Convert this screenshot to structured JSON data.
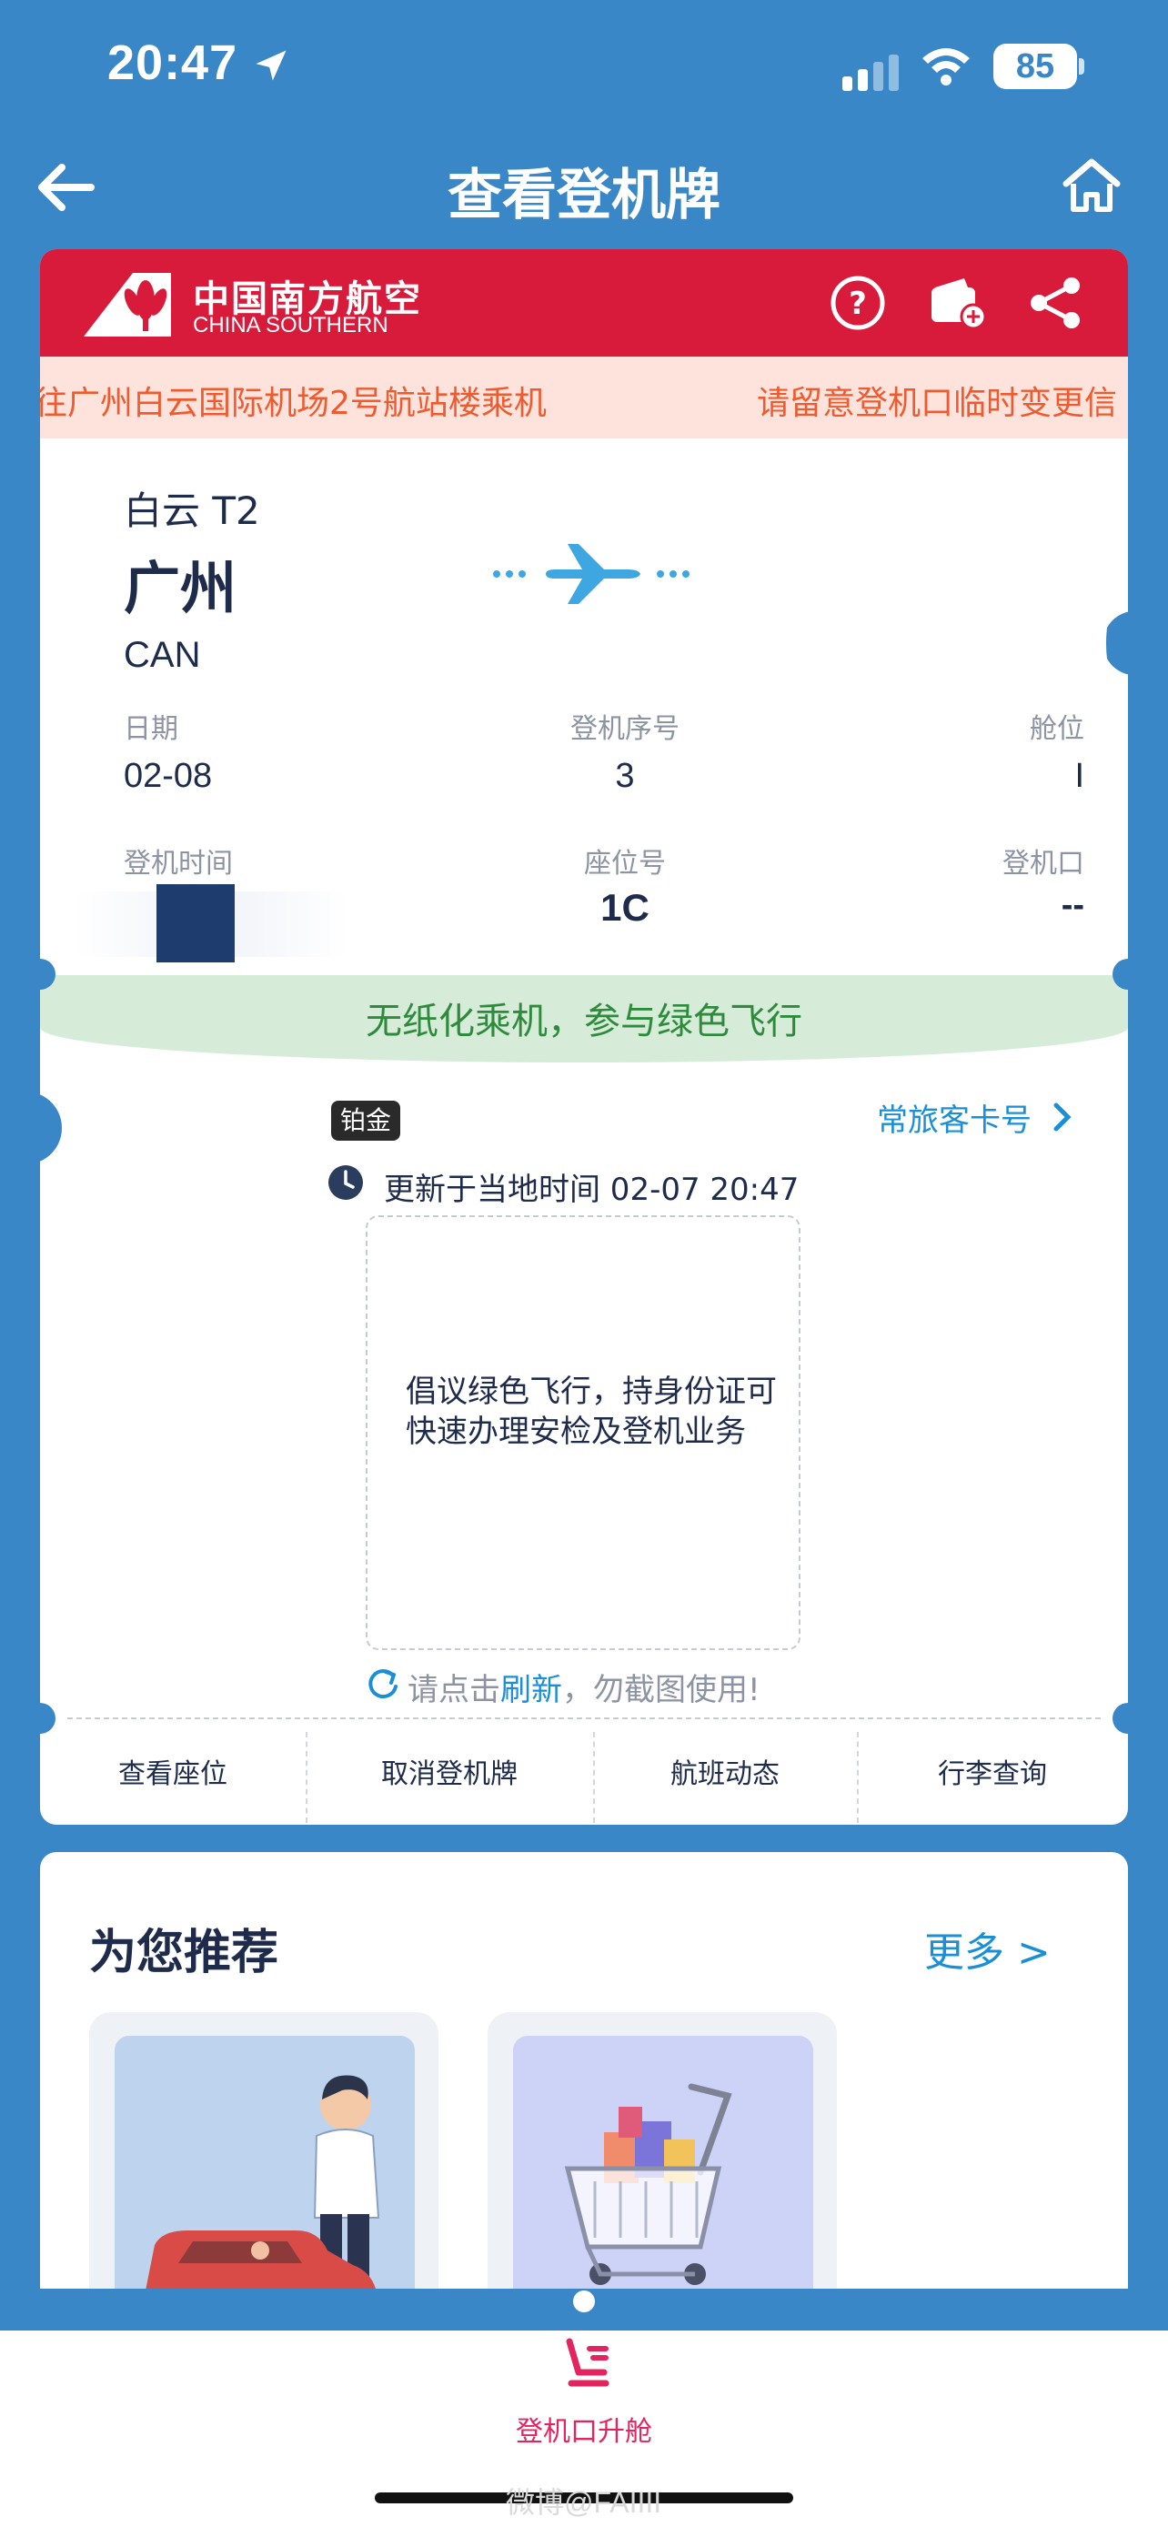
{
  "status_bar": {
    "time": "20:47",
    "battery": "85"
  },
  "nav": {
    "title": "查看登机牌"
  },
  "header": {
    "logo_cn": "中国南方航空",
    "logo_en": "CHINA SOUTHERN"
  },
  "marquee": {
    "text1": "往广州白云国际机场2号航站楼乘机",
    "text2": "请留意登机口临时变更信"
  },
  "origin": {
    "terminal": "白云 T2",
    "city": "广州",
    "code": "CAN"
  },
  "fields": {
    "date_label": "日期",
    "date": "02-08",
    "seq_label": "登机序号",
    "seq": "3",
    "cabin_label": "舱位",
    "cabin": "I",
    "btime_label": "登机时间",
    "seat_label": "座位号",
    "seat": "1C",
    "gate_label": "登机口",
    "gate": "--"
  },
  "green_banner": "无纸化乘机，参与绿色飞行",
  "member": {
    "tier": "铂金",
    "ff_link": "常旅客卡号"
  },
  "updated": "更新于当地时间 02-07 20:47",
  "qr_message": "倡议绿色飞行，持身份证可快速办理安检及登机业务",
  "refresh": {
    "prefix": "请点击",
    "link": "刷新",
    "suffix": "，勿截图使用!"
  },
  "actions": [
    "查看座位",
    "取消登机牌",
    "航班动态",
    "行李查询"
  ],
  "recommend": {
    "title": "为您推荐",
    "more": "更多 >"
  },
  "bottom": {
    "upgrade_label": "登机口升舱"
  },
  "watermark": "微博@FAIIII",
  "colors": {
    "brand_red": "#d81a3b",
    "page_blue": "#3a87c7",
    "link_blue": "#1b8fd6",
    "green_text": "#2f8b3c",
    "marquee_orange": "#ef5a2f"
  }
}
